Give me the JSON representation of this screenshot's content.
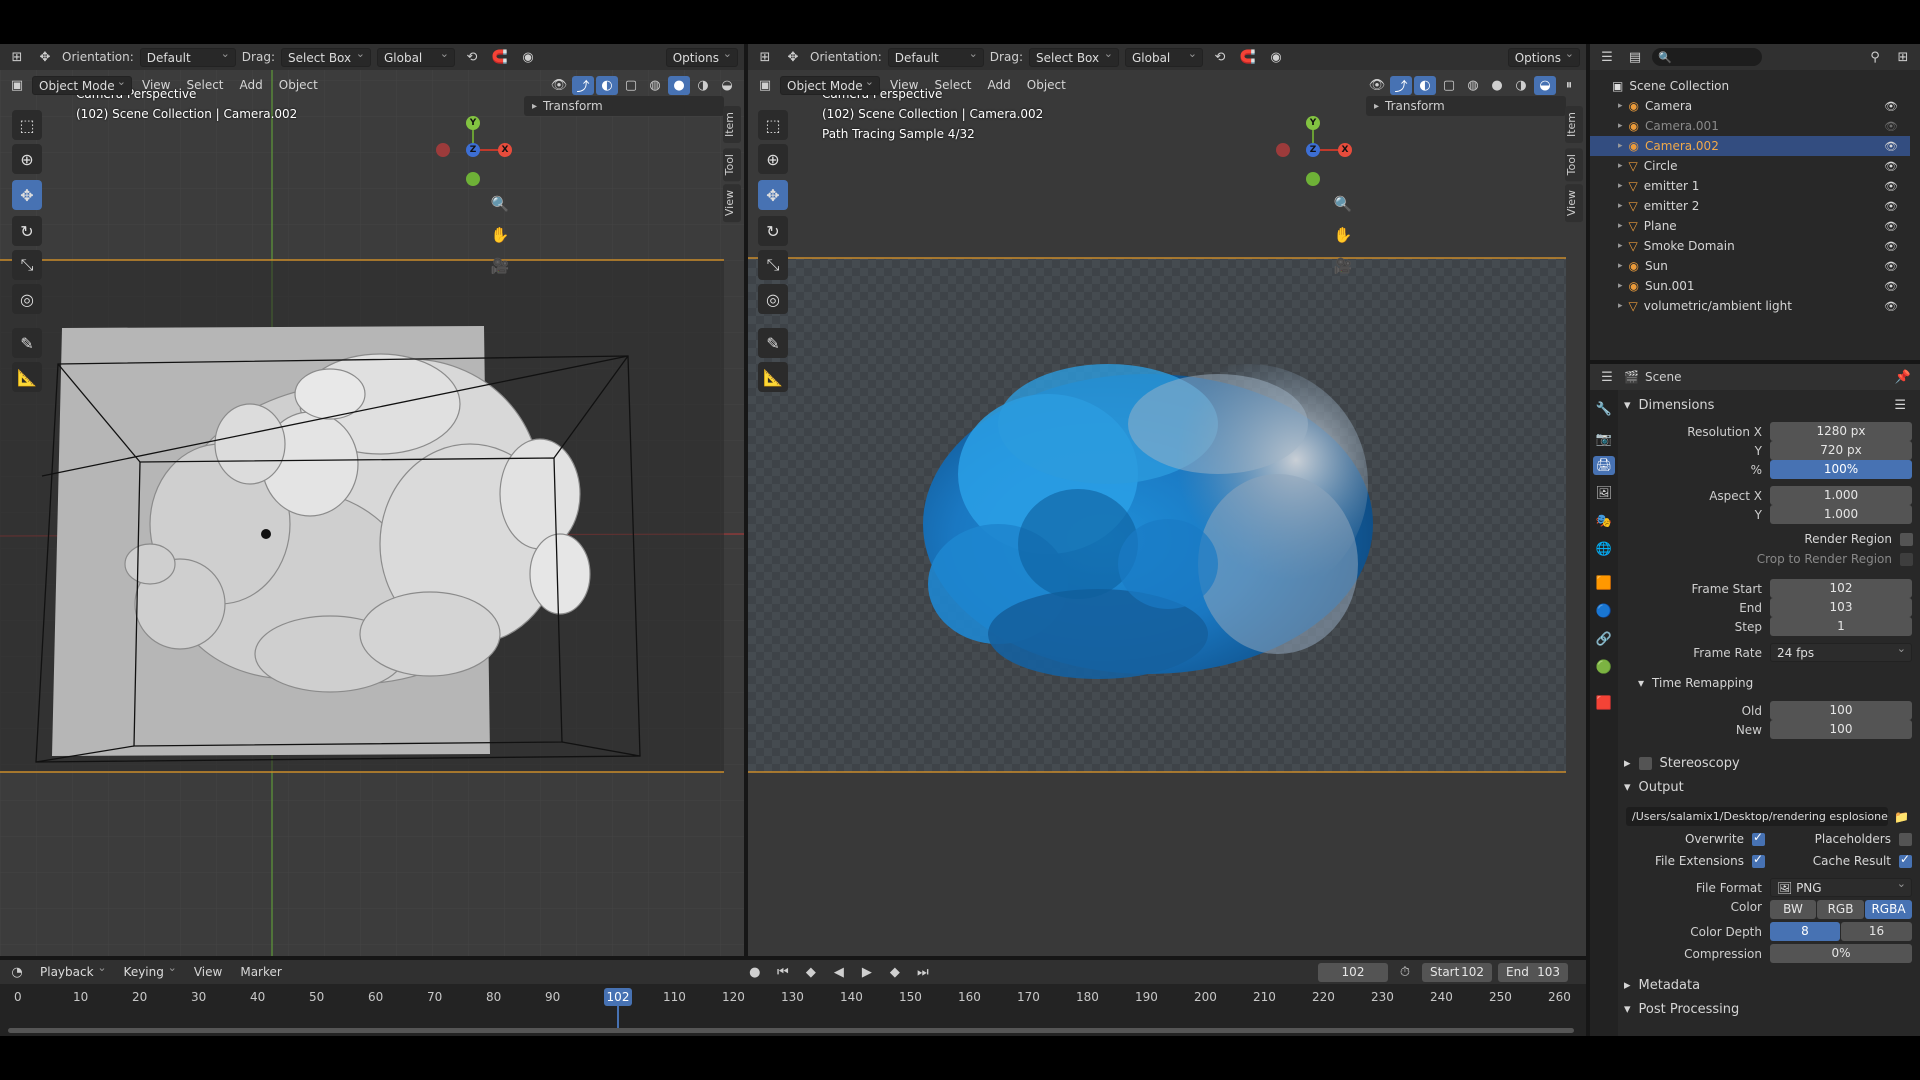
{
  "left_viewport": {
    "header": {
      "orientation_label": "Orientation:",
      "orientation_value": "Default",
      "drag_label": "Drag:",
      "drag_value": "Select Box",
      "transform_space": "Global",
      "options": "Options"
    },
    "menubar": {
      "mode": "Object Mode",
      "items": [
        "View",
        "Select",
        "Add",
        "Object"
      ]
    },
    "overlay_line1": "Camera Perspective",
    "overlay_line2": "(102) Scene Collection | Camera.002",
    "n_panel_header": "Transform",
    "side_tabs": [
      "Item",
      "Tool",
      "View"
    ]
  },
  "right_viewport": {
    "header": {
      "orientation_label": "Orientation:",
      "orientation_value": "Default",
      "drag_label": "Drag:",
      "drag_value": "Select Box",
      "transform_space": "Global",
      "options": "Options"
    },
    "menubar": {
      "mode": "Object Mode",
      "items": [
        "View",
        "Select",
        "Add",
        "Object"
      ]
    },
    "overlay_line1": "Camera Perspective",
    "overlay_line2": "(102) Scene Collection | Camera.002",
    "overlay_line3": "Path Tracing Sample 4/32",
    "n_panel_header": "Transform",
    "side_tabs": [
      "Item",
      "Tool",
      "View"
    ]
  },
  "outliner": {
    "root": "Scene Collection",
    "items": [
      {
        "name": "Camera",
        "selected": false,
        "dim": false
      },
      {
        "name": "Camera.001",
        "selected": false,
        "dim": true
      },
      {
        "name": "Camera.002",
        "selected": true,
        "dim": false
      },
      {
        "name": "Circle",
        "selected": false,
        "dim": false
      },
      {
        "name": "emitter 1",
        "selected": false,
        "dim": false
      },
      {
        "name": "emitter 2",
        "selected": false,
        "dim": false
      },
      {
        "name": "Plane",
        "selected": false,
        "dim": false
      },
      {
        "name": "Smoke Domain",
        "selected": false,
        "dim": false
      },
      {
        "name": "Sun",
        "selected": false,
        "dim": false
      },
      {
        "name": "Sun.001",
        "selected": false,
        "dim": false
      },
      {
        "name": "volumetric/ambient light",
        "selected": false,
        "dim": false
      }
    ]
  },
  "properties": {
    "context": "Scene",
    "dimensions": {
      "title": "Dimensions",
      "res_x_label": "Resolution X",
      "res_x": "1280 px",
      "res_y_label": "Y",
      "res_y": "720 px",
      "pct_label": "%",
      "pct": "100%",
      "aspect_x_label": "Aspect X",
      "aspect_x": "1.000",
      "aspect_y_label": "Y",
      "aspect_y": "1.000",
      "render_region": "Render Region",
      "crop": "Crop to Render Region",
      "frame_start_label": "Frame Start",
      "frame_start": "102",
      "end_label": "End",
      "end": "103",
      "step_label": "Step",
      "step": "1",
      "frame_rate_label": "Frame Rate",
      "frame_rate": "24 fps"
    },
    "time_remapping": {
      "title": "Time Remapping",
      "old_label": "Old",
      "old": "100",
      "new_label": "New",
      "new": "100"
    },
    "stereoscopy": "Stereoscopy",
    "output": {
      "title": "Output",
      "path": "/Users/salamix1/Desktop/rendering esplosione",
      "overwrite": "Overwrite",
      "placeholders": "Placeholders",
      "file_ext": "File Extensions",
      "cache": "Cache Result",
      "format_label": "File Format",
      "format": "PNG",
      "color_label": "Color",
      "color_opts": [
        "BW",
        "RGB",
        "RGBA"
      ],
      "depth_label": "Color Depth",
      "depth_opts": [
        "8",
        "16"
      ],
      "compression_label": "Compression",
      "compression": "0%"
    },
    "metadata": "Metadata",
    "post": "Post Processing"
  },
  "timeline": {
    "menus": [
      "Playback",
      "Keying",
      "View",
      "Marker"
    ],
    "current_frame": "102",
    "start_label": "Start",
    "start": "102",
    "end_label": "End",
    "end": "103",
    "ticks": [
      "0",
      "10",
      "20",
      "30",
      "40",
      "50",
      "60",
      "70",
      "80",
      "90",
      "1",
      "110",
      "120",
      "130",
      "140",
      "150",
      "160",
      "170",
      "180",
      "190",
      "200",
      "210",
      "220",
      "230",
      "240",
      "250",
      "260"
    ]
  },
  "colors": {
    "accent": "#4772b3",
    "header": "#303030",
    "viewport": "#3a3a3a",
    "panel": "#2b2b2b"
  }
}
